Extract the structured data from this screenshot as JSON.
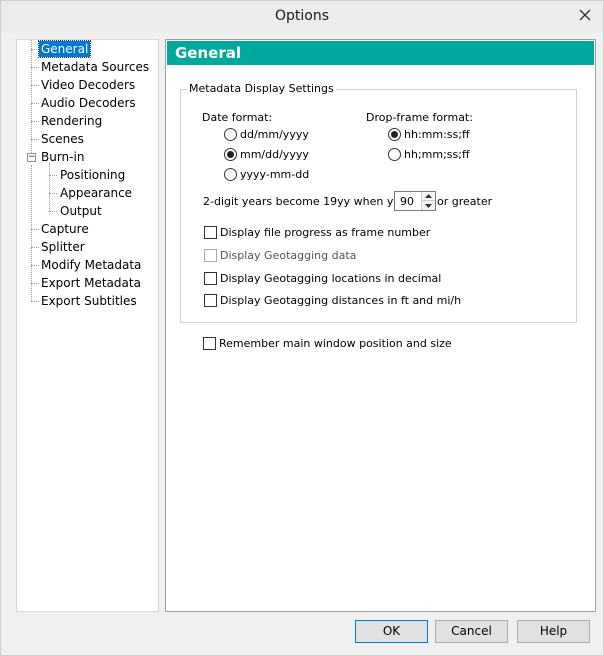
{
  "window": {
    "title": "Options"
  },
  "tree": {
    "items": [
      {
        "label": "General",
        "level": 0,
        "selected": true
      },
      {
        "label": "Metadata Sources",
        "level": 0
      },
      {
        "label": "Video Decoders",
        "level": 0
      },
      {
        "label": "Audio Decoders",
        "level": 0
      },
      {
        "label": "Rendering",
        "level": 0
      },
      {
        "label": "Scenes",
        "level": 0
      },
      {
        "label": "Burn-in",
        "level": 0,
        "expanded": true
      },
      {
        "label": "Positioning",
        "level": 1
      },
      {
        "label": "Appearance",
        "level": 1
      },
      {
        "label": "Output",
        "level": 1
      },
      {
        "label": "Capture",
        "level": 0
      },
      {
        "label": "Splitter",
        "level": 0
      },
      {
        "label": "Modify Metadata",
        "level": 0
      },
      {
        "label": "Export Metadata",
        "level": 0
      },
      {
        "label": "Export Subtitles",
        "level": 0
      }
    ]
  },
  "panel": {
    "header": "General",
    "group_title": "Metadata Display Settings",
    "date_format": {
      "label": "Date format:",
      "options": [
        "dd/mm/yyyy",
        "mm/dd/yyyy",
        "yyyy-mm-dd"
      ],
      "selected": 1
    },
    "drop_frame": {
      "label": "Drop-frame format:",
      "options": [
        "hh:mm:ss;ff",
        "hh;mm;ss;ff"
      ],
      "selected": 0
    },
    "year_rule": {
      "prefix": "2-digit years become 19yy when yy is",
      "value": "90",
      "suffix": "or greater"
    },
    "checks": [
      {
        "label": "Display file progress as frame number",
        "checked": false,
        "enabled": true
      },
      {
        "label": "Display Geotagging data",
        "checked": false,
        "enabled": false
      },
      {
        "label": "Display Geotagging locations in decimal",
        "checked": false,
        "enabled": true
      },
      {
        "label": "Display Geotagging distances in ft and mi/h",
        "checked": false,
        "enabled": true
      }
    ],
    "remember": {
      "label": "Remember main window position and size",
      "checked": false
    }
  },
  "buttons": {
    "ok": "OK",
    "cancel": "Cancel",
    "help": "Help"
  },
  "colors": {
    "header_bg": "#00a99d",
    "selection": "#0078d7"
  }
}
